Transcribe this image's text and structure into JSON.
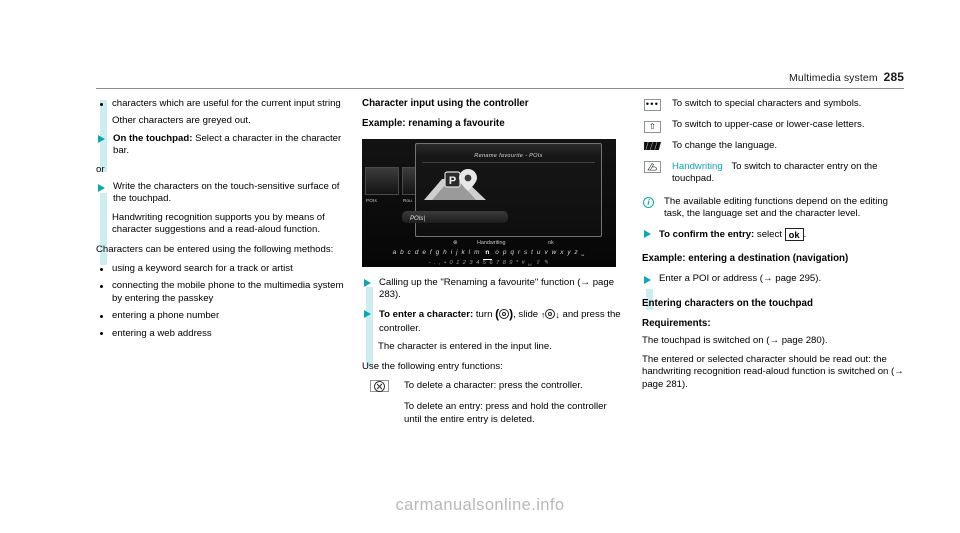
{
  "header": {
    "title": "Multimedia system",
    "page_number": "285"
  },
  "col1": {
    "bullet1": "characters which are useful for the current input string",
    "note1": "Other characters are greyed out.",
    "step1_bold": "On the touchpad:",
    "step1_rest": " Select a character in the character bar.",
    "or": "or",
    "step2": "Write the characters on the touch-sensitive surface of the touchpad.",
    "step2_cont": "Handwriting recognition supports you by means of character suggestions and a read-aloud function.",
    "para1": "Characters can be entered using the following methods:",
    "bullets": [
      "using a keyword search for a track or artist",
      "connecting the mobile phone to the multimedia system by entering the passkey",
      "entering a phone number",
      "entering a web address"
    ]
  },
  "col2": {
    "heading1": "Character input using the controller",
    "heading2": "Example: renaming a favourite",
    "figure": {
      "dialog_title": "Rename favourite - POIs",
      "tile_labels": [
        "POIs",
        "Rou"
      ],
      "input_value": "POIs|",
      "toolbar": {
        "delete_icon": "⊗",
        "handwriting_label": "Handwriting",
        "ok_label": "ok"
      },
      "keyboard_row1_left": "a b c d e f g h i j k l m",
      "keyboard_row1_selected": "n",
      "keyboard_row1_right": "o p q r s t u v w x y z",
      "keyboard_row1_end": "⎵",
      "keyboard_row2": "- . , • 0 1 2 3 4 5 6 7 8 9 * #  ␣  ⇧  ✎"
    },
    "step1": "Calling up the \"Renaming a favourite\" function (→ page 283).",
    "step2_bold": "To enter a character:",
    "step2_mid": " turn ",
    "step2_mid2": ", slide ",
    "step2_rest": " and press the controller.",
    "step2_cont": "The character is entered in the input line.",
    "para_use": "Use the following entry functions:",
    "delete_char": "To delete a character: press the controller.",
    "delete_entry": "To delete an entry: press and hold the controller until the entire entry is deleted."
  },
  "col3": {
    "icon_rows": [
      {
        "icon": "special-characters-icon",
        "text": "To switch to special characters and symbols."
      },
      {
        "icon": "shift-case-icon",
        "text": "To switch to upper-case or lower-case letters."
      },
      {
        "icon": "language-icon",
        "text": "To change the language."
      }
    ],
    "handwriting_label": "Handwriting",
    "handwriting_text": "To switch to character entry on the touchpad.",
    "info_note": "The available editing functions depend on the editing task, the language set and the character level.",
    "confirm_bold": "To confirm the entry:",
    "confirm_mid": " select ",
    "confirm_key": "ok",
    "confirm_end": ".",
    "heading_example": "Example: entering a destination (navigation)",
    "example_step": "Enter a POI or address (→ page 295).",
    "heading_touchpad": "Entering characters on the touchpad",
    "heading_req": "Requirements:",
    "req1": "The touchpad is switched on (→ page 280).",
    "req2": "The entered or selected character should be read out: the handwriting recognition read-aloud function is switched on (→ page 281)."
  },
  "watermark": "carmanualsonline.info"
}
